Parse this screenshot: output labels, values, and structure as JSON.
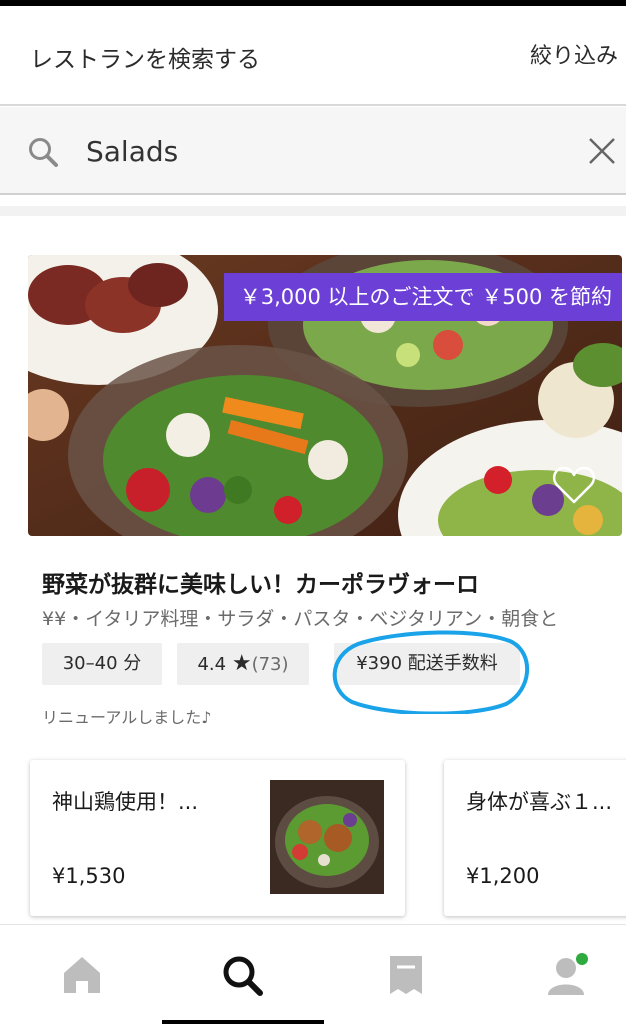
{
  "header": {
    "title": "レストランを検索する",
    "filter_label": "絞り込み"
  },
  "search": {
    "query": "Salads",
    "icon": "search-icon",
    "clear_icon": "close-icon"
  },
  "featured": {
    "promo": "￥3,000 以上のご注文で ￥500 を節約",
    "name": "野菜が抜群に美味しい！カーポラヴォーロ",
    "meta": "¥¥・イタリア料理・サラダ・パスタ・ベジタリアン・朝食と",
    "time": "30–40 分",
    "rating": "4.4",
    "rating_count": "(73)",
    "delivery_fee": "¥390 配送手数料",
    "note": "リニューアルしました♪",
    "favorite_icon": "heart-outline-icon"
  },
  "dishes": [
    {
      "name": "神山鶏使用！...",
      "price": "¥1,530"
    },
    {
      "name": "身体が喜ぶ１...",
      "price": "¥1,200"
    }
  ],
  "nav": {
    "items": [
      "home-icon",
      "search-icon",
      "orders-icon",
      "account-icon"
    ],
    "active": "search-icon"
  },
  "colors": {
    "promo_bg": "#6c3fd6",
    "highlight_ring": "#1aa3e8",
    "notification_dot": "#2eaa3f"
  }
}
